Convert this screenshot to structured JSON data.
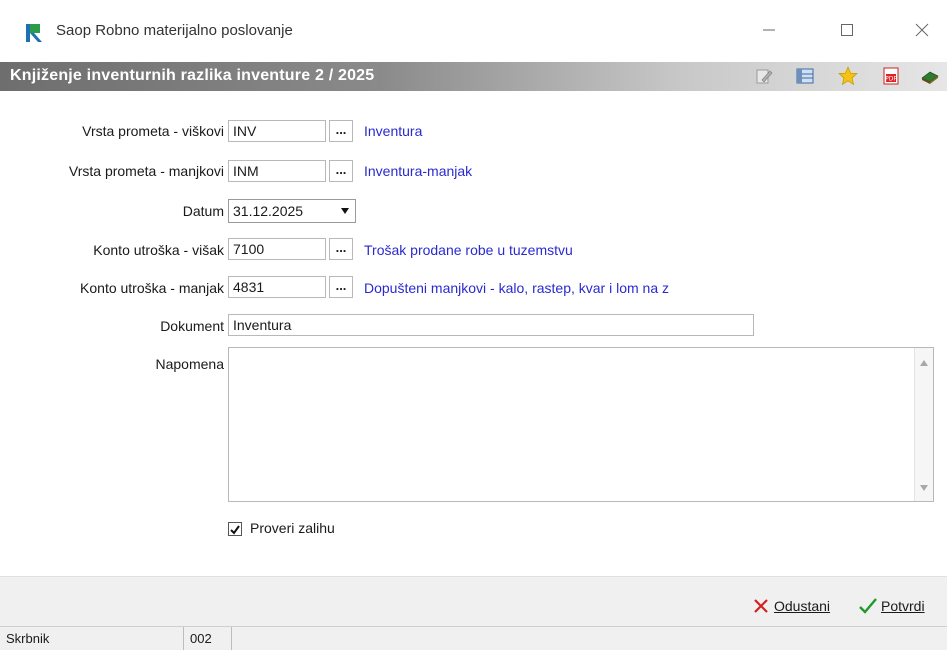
{
  "window": {
    "app_title": "Saop Robno materijalno poslovanje",
    "header_title": "Knjiženje inventurnih razlika inventure 2 / 2025"
  },
  "form": {
    "vrsta_visak": {
      "label": "Vrsta prometa - viškovi",
      "value": "INV",
      "desc": "Inventura"
    },
    "vrsta_manjak": {
      "label": "Vrsta prometa - manjkovi",
      "value": "INM",
      "desc": "Inventura-manjak"
    },
    "datum": {
      "label": "Datum",
      "value": "31.12.2025"
    },
    "konto_visak": {
      "label": "Konto utroška - višak",
      "value": "7100",
      "desc": "Trošak prodane robe u tuzemstvu"
    },
    "konto_manjak": {
      "label": "Konto utroška - manjak",
      "value": "4831",
      "desc": "Dopušteni manjkovi - kalo, rastep, kvar i lom na z"
    },
    "dokument": {
      "label": "Dokument",
      "value": "Inventura"
    },
    "napomena": {
      "label": "Napomena",
      "value": ""
    },
    "proveri": {
      "label": "Proveri zalihu",
      "checked": true
    },
    "dots_label": "..."
  },
  "footer": {
    "cancel_label": "Odustani",
    "confirm_label": "Potvrdi"
  },
  "statusbar": {
    "user": "Skrbnik",
    "code": "002",
    "message": ""
  },
  "icons": [
    "app-logo-icon",
    "minimize-icon",
    "maximize-icon",
    "close-icon",
    "edit-icon",
    "columns-icon",
    "star-icon",
    "pdf-icon",
    "book-icon",
    "ellipsis-icon",
    "dropdown-arrow-icon",
    "checkbox-icon",
    "cancel-x-icon",
    "confirm-check-icon"
  ]
}
